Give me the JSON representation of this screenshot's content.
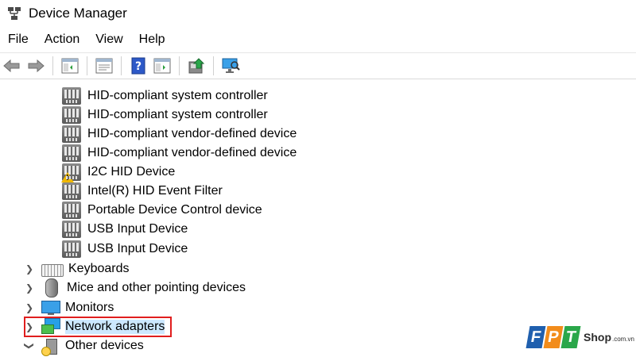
{
  "window": {
    "title": "Device Manager"
  },
  "menu": [
    "File",
    "Action",
    "View",
    "Help"
  ],
  "toolbar": {
    "buttons": [
      "back-arrow-icon",
      "forward-arrow-icon",
      "show-hide-console-tree-icon",
      "properties-icon",
      "help-icon",
      "view-icon",
      "update-driver-icon",
      "scan-hardware-icon"
    ]
  },
  "tree": {
    "hid_children": [
      "HID-compliant system controller",
      "HID-compliant system controller",
      "HID-compliant vendor-defined device",
      "HID-compliant vendor-defined device",
      "I2C HID Device",
      "Intel(R) HID Event Filter",
      "Portable Device Control device",
      "USB Input Device",
      "USB Input Device"
    ],
    "categories": [
      {
        "label": "Keyboards",
        "expanded": false
      },
      {
        "label": "Mice and other pointing devices",
        "expanded": false
      },
      {
        "label": "Monitors",
        "expanded": false
      },
      {
        "label": "Network adapters",
        "expanded": false,
        "selected": true
      },
      {
        "label": "Other devices",
        "expanded": true
      }
    ]
  },
  "colors": {
    "highlight": "#e01e1e",
    "selection": "#cce8ff"
  },
  "watermark": {
    "brand_f": "F",
    "brand_p": "P",
    "brand_t": "T",
    "shop": "Shop",
    "domain": ".com.vn"
  }
}
